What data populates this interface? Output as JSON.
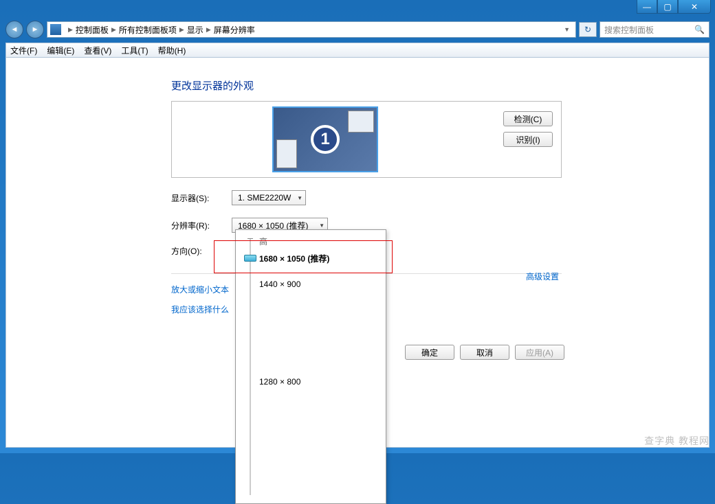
{
  "window": {
    "min": "—",
    "max": "▢",
    "close": "✕"
  },
  "breadcrumb": {
    "root": "控制面板",
    "all": "所有控制面板项",
    "display": "显示",
    "current": "屏幕分辨率"
  },
  "search": {
    "placeholder": "搜索控制面板"
  },
  "menu": {
    "file": "文件(F)",
    "edit": "编辑(E)",
    "view": "查看(V)",
    "tools": "工具(T)",
    "help": "帮助(H)"
  },
  "page": {
    "title": "更改显示器的外观",
    "detect": "检测(C)",
    "identify": "识别(I)",
    "monitor_num": "1",
    "label_display": "显示器(S):",
    "display_value": "1. SME2220W",
    "label_res": "分辨率(R):",
    "res_value": "1680 × 1050 (推荐)",
    "label_orient": "方向(O):",
    "advanced": "高级设置",
    "link_textsize": "放大或缩小文本",
    "link_which": "我应该选择什么",
    "ok": "确定",
    "cancel": "取消",
    "apply": "应用(A)"
  },
  "flyout": {
    "high": "高",
    "opt1": "1680 × 1050 (推荐)",
    "opt2": "1440 × 900",
    "opt3": "1280 × 800"
  },
  "watermark": "查字典 教程网"
}
